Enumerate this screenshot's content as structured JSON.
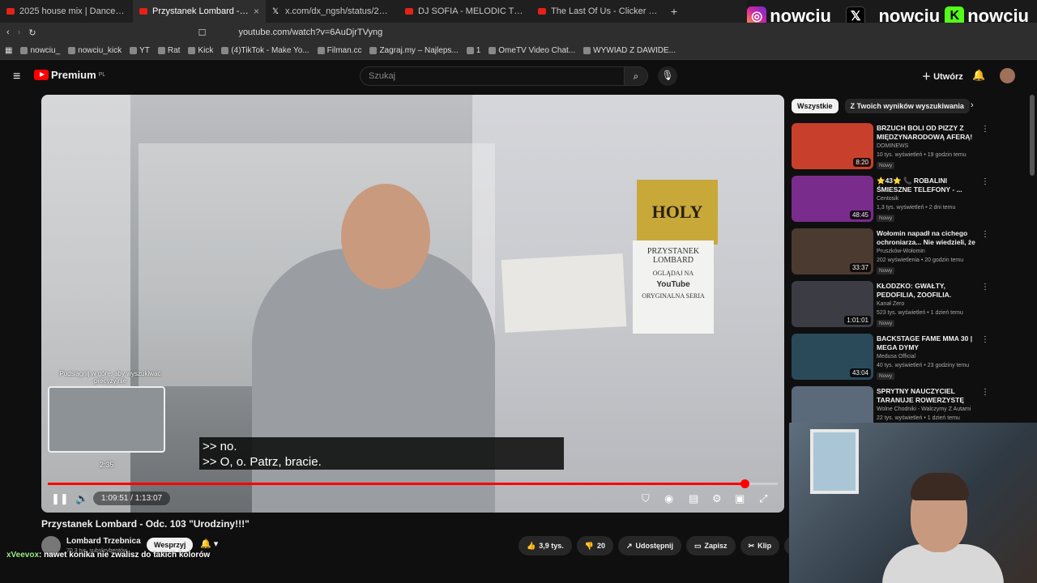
{
  "browser": {
    "tabs": [
      {
        "title": "2025 house mix | Dance Bangers - Yo",
        "icon": "youtube-icon"
      },
      {
        "title": "Przystanek Lombard - Odc. 1(",
        "icon": "youtube-icon",
        "active": true
      },
      {
        "title": "x.com/dx_ngsh/status/20374209037(",
        "icon": "x-icon"
      },
      {
        "title": "DJ SOFIA - MELODIC TECHNO & FUT",
        "icon": "youtube-icon"
      },
      {
        "title": "The Last Of Us - Clicker Sound Effect",
        "icon": "youtube-icon"
      }
    ],
    "new_tab": "+",
    "url": "youtube.com/watch?v=6AuDjrTVyng",
    "bookmarks": [
      "nowciu_",
      "nowciu_kick",
      "YT",
      "Rat",
      "Kick",
      "(4)TikTok - Make Yo...",
      "Filman.cc",
      "Zagraj.my – Najleps...",
      "1",
      "OmeTV Video Chat...",
      "WYWIAD Z DAWIDE..."
    ]
  },
  "stream_overlay": {
    "instagram": "nowciu_",
    "x": "_nowciu",
    "kick": "nowciu"
  },
  "youtube": {
    "logo": "Premium",
    "logo_region": "PL",
    "search_placeholder": "Szukaj",
    "create_label": "Utwórz"
  },
  "player": {
    "hint": "Podsiągnij w górę, aby wyszukiwać precyzyjnie",
    "preview_time": "2:35",
    "subtitle_line1": ">> no.",
    "subtitle_line2": ">> O, o. Patrz, bracie.",
    "time": "1:09:51 / 1:13:07",
    "progress": 0.955,
    "sign_text": "PRZYSTANEK LOMBARD",
    "sign_sub": "OGLĄDAJ NA",
    "sign_yt": "YouTube",
    "sign_bottom": "ORYGINALNA SERIA",
    "gold_sign": "HOLY"
  },
  "video": {
    "title": "Przystanek Lombard - Odc. 103 \"Urodziny!!!\"",
    "channel": "Lombard Trzebnica",
    "subscribers": "70,3 tys. subskrybentów",
    "support_label": "Wesprzyj",
    "likes": "3,9 tys.",
    "dislikes": "20",
    "share": "Udostępnij",
    "save": "Zapisz",
    "clip": "Klip"
  },
  "chat": {
    "user": "xVeevox",
    "message": ": nawet konika nie zwalisz do takich kolorów"
  },
  "sidebar": {
    "chips": [
      "Wszystkie",
      "Z Twoich wyników wyszukiwania"
    ],
    "videos": [
      {
        "title": "BRZUCH BOLI OD PIZZY Z MIĘDZYNARODOWĄ AFERĄ!",
        "channel": "DOMINEWS",
        "meta": "10 tys. wyświetleń • 19 godzin temu",
        "badge": "Nowy",
        "duration": "8:20",
        "thumb": "#c8402c"
      },
      {
        "title": "⭐43⭐ 📞 ROBALINI ŚMIESZNE TELEFONY - ...",
        "channel": "Centosik",
        "meta": "1,3 tys. wyświetleń • 2 dni temu",
        "badge": "Nowy",
        "duration": "48:45",
        "thumb": "#7a2c8c"
      },
      {
        "title": "Wołomin napadł na cichego ochroniarza... Nie wiedzieli, że ...",
        "channel": "Pruszków-Wołomin",
        "meta": "202 wyświetlenia • 20 godzin temu",
        "badge": "Nowy",
        "duration": "33:37",
        "thumb": "#4a3a30"
      },
      {
        "title": "KŁODZKO: GWAŁTY, PEDOFILIA, ZOOFILIA. WSTRZĄSAJĄCE ...",
        "channel": "Kanał Zero",
        "meta": "523 tys. wyświetleń • 1 dzień temu",
        "badge": "Nowy",
        "duration": "1:01:01",
        "thumb": "#3c3c44"
      },
      {
        "title": "BACKSTAGE FAME MMA 30 | MEGA DYMY",
        "channel": "Medusa Official",
        "meta": "40 tys. wyświetleń • 23 godziny temu",
        "badge": "Nowy",
        "duration": "43:04",
        "thumb": "#2a4a5a"
      },
      {
        "title": "SPRYTNY NAUCZYCIEL TARANUJE ROWERZYSTĘ PO...",
        "channel": "Wolne Chodniki - Walczymy Z Autami",
        "meta": "22 tys. wyświetleń • 1 dzień temu",
        "badge": "",
        "duration": "",
        "thumb": "#5a6a7a"
      }
    ]
  }
}
